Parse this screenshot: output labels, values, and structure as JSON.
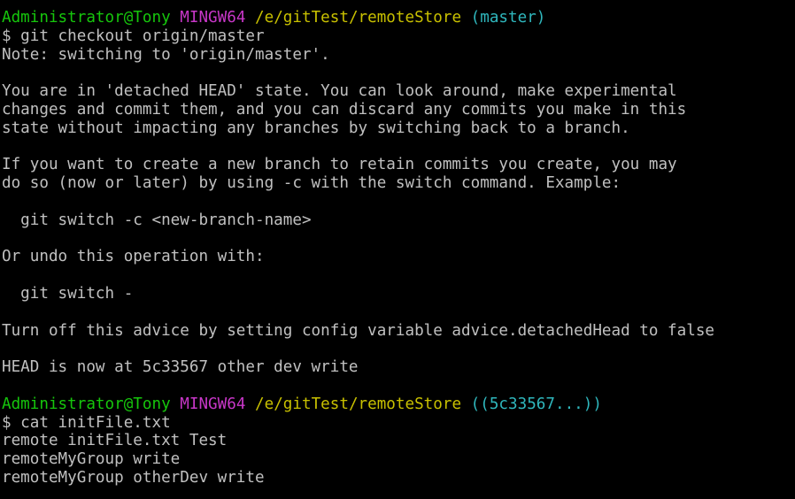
{
  "prompts": [
    {
      "user_host": "Administrator@Tony",
      "system": "MINGW64",
      "path": "/e/gitTest/remoteStore",
      "branch": "(master)"
    },
    {
      "user_host": "Administrator@Tony",
      "system": "MINGW64",
      "path": "/e/gitTest/remoteStore",
      "branch": "((5c33567...))"
    }
  ],
  "commands": [
    "$ git checkout origin/master",
    "$ cat initFile.txt"
  ],
  "output_block_1": [
    "Note: switching to 'origin/master'.",
    "",
    "You are in 'detached HEAD' state. You can look around, make experimental",
    "changes and commit them, and you can discard any commits you make in this",
    "state without impacting any branches by switching back to a branch.",
    "",
    "If you want to create a new branch to retain commits you create, you may",
    "do so (now or later) by using -c with the switch command. Example:",
    "",
    "  git switch -c <new-branch-name>",
    "",
    "Or undo this operation with:",
    "",
    "  git switch -",
    "",
    "Turn off this advice by setting config variable advice.detachedHead to false",
    "",
    "HEAD is now at 5c33567 other dev write",
    ""
  ],
  "output_block_2": [
    "remote initFile.txt Test",
    "remoteMyGroup write",
    "remoteMyGroup otherDev write"
  ],
  "colors": {
    "background": "#000000",
    "text": "#c0c0c0",
    "user_host": "#16c60c",
    "system": "#c837c8",
    "path": "#c8c000",
    "branch": "#2fb7bd"
  }
}
